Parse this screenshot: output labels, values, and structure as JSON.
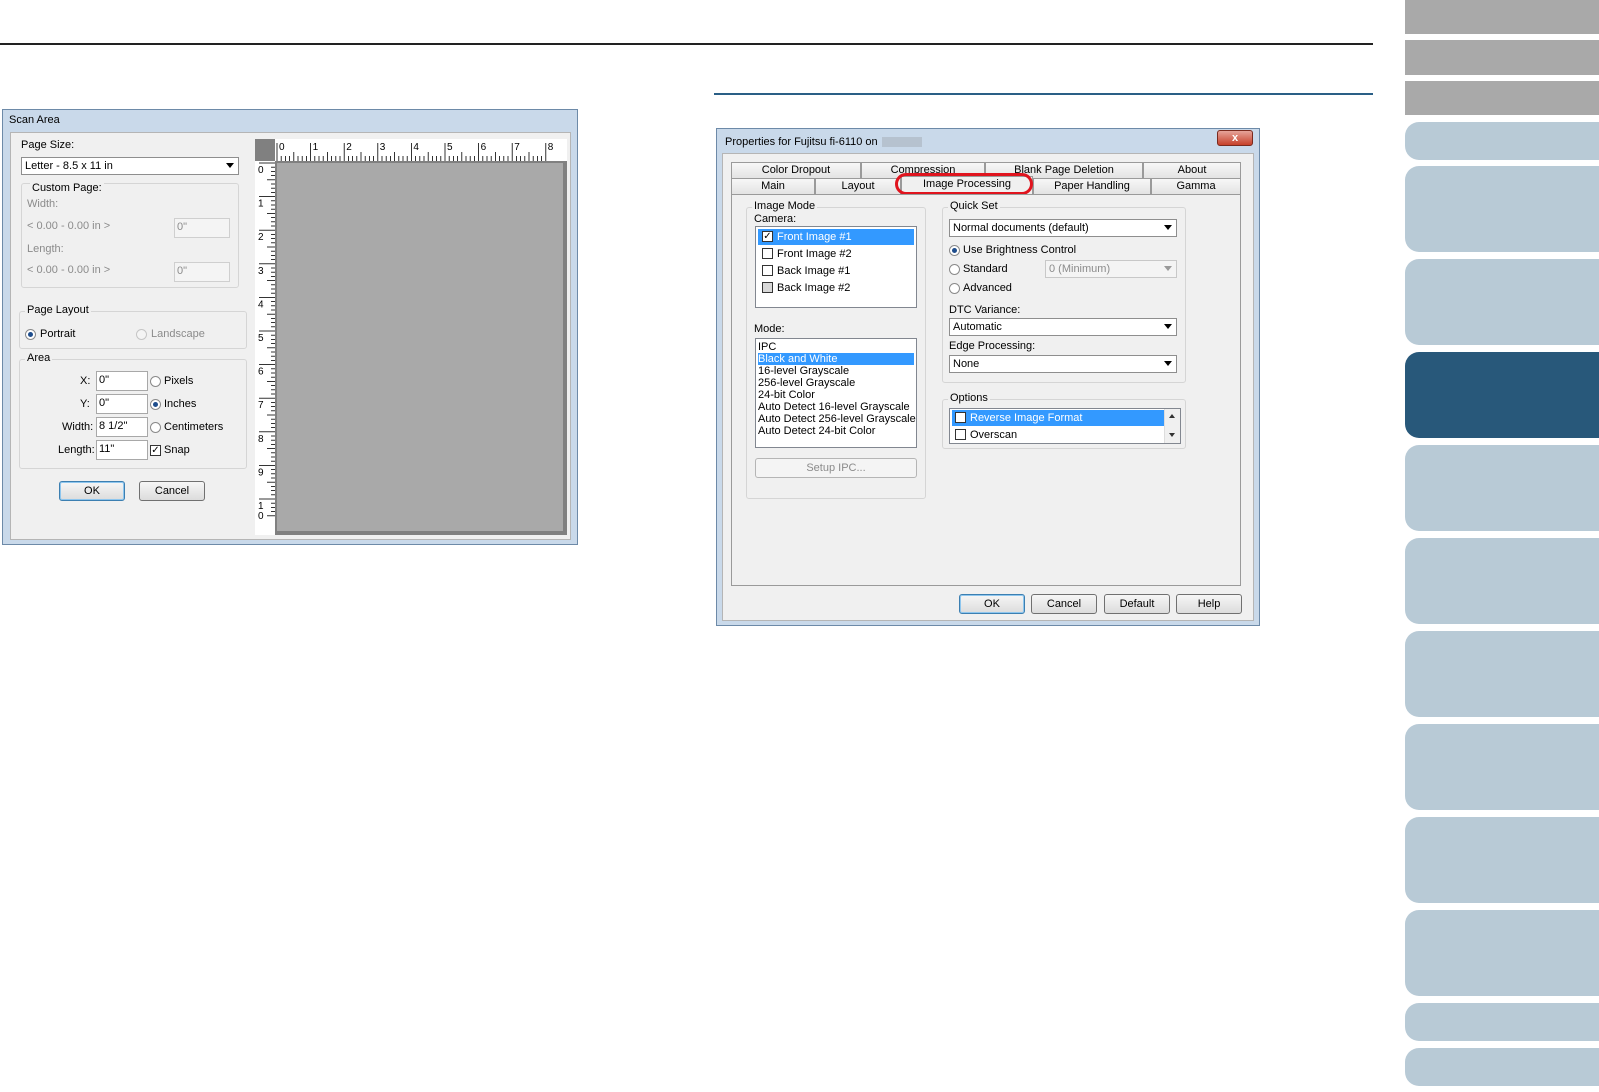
{
  "nav": {
    "tabs": 16
  },
  "scan_area": {
    "title": "Scan Area",
    "page_size_label": "Page Size:",
    "page_size_value": "Letter - 8.5 x 11 in",
    "custom_page_label": "Custom Page:",
    "width_label": "Width:",
    "width_range": "< 0.00 - 0.00 in >",
    "width_value": "0\"",
    "length_label": "Length:",
    "length_range": "< 0.00 - 0.00 in >",
    "length_value": "0\"",
    "page_layout_label": "Page Layout",
    "portrait_label": "Portrait",
    "landscape_label": "Landscape",
    "area_label": "Area",
    "x_label": "X:",
    "x_value": "0\"",
    "y_label": "Y:",
    "y_value": "0\"",
    "area_width_label": "Width:",
    "area_width_value": "8 1/2\"",
    "area_length_label": "Length:",
    "area_length_value": "11\"",
    "pixels_label": "Pixels",
    "inches_label": "Inches",
    "centimeters_label": "Centimeters",
    "snap_label": "Snap",
    "ok_label": "OK",
    "cancel_label": "Cancel",
    "ruler_h": [
      "0",
      "1",
      "2",
      "3",
      "4",
      "5",
      "6",
      "7",
      "8"
    ],
    "ruler_v": [
      "0",
      "1",
      "2",
      "3",
      "4",
      "5",
      "6",
      "7",
      "8",
      "9",
      "1\n0"
    ]
  },
  "properties": {
    "title": "Properties for Fujitsu fi-6110 on",
    "close_label": "x",
    "tabs_row1": [
      "Color Dropout",
      "Compression",
      "Blank Page Deletion",
      "About"
    ],
    "tabs_row2": [
      "Main",
      "Layout",
      "Image Processing",
      "Paper Handling",
      "Gamma"
    ],
    "image_mode_label": "Image Mode",
    "camera_label": "Camera:",
    "camera_items": [
      {
        "label": "Front Image #1",
        "checked": true
      },
      {
        "label": "Front Image #2",
        "checked": false
      },
      {
        "label": "Back Image #1",
        "checked": false
      },
      {
        "label": "Back Image #2",
        "checked": false
      }
    ],
    "mode_label": "Mode:",
    "mode_items": [
      "IPC",
      "Black and White",
      "16-level Grayscale",
      "256-level Grayscale",
      "24-bit Color",
      "Auto Detect 16-level Grayscale",
      "Auto Detect 256-level Grayscale",
      "Auto Detect 24-bit Color"
    ],
    "setup_ipc_label": "Setup IPC...",
    "quick_set_label": "Quick Set",
    "quick_set_value": "Normal documents (default)",
    "use_brightness_label": "Use Brightness Control",
    "standard_label": "Standard",
    "standard_value": "0 (Minimum)",
    "advanced_label": "Advanced",
    "dtc_label": "DTC Variance:",
    "dtc_value": "Automatic",
    "edge_label": "Edge Processing:",
    "edge_value": "None",
    "options_label": "Options",
    "option_items": [
      "Reverse Image Format",
      "Overscan"
    ],
    "ok_label": "OK",
    "cancel_label": "Cancel",
    "default_label": "Default",
    "help_label": "Help",
    "highlight_color": "#e0141e"
  }
}
